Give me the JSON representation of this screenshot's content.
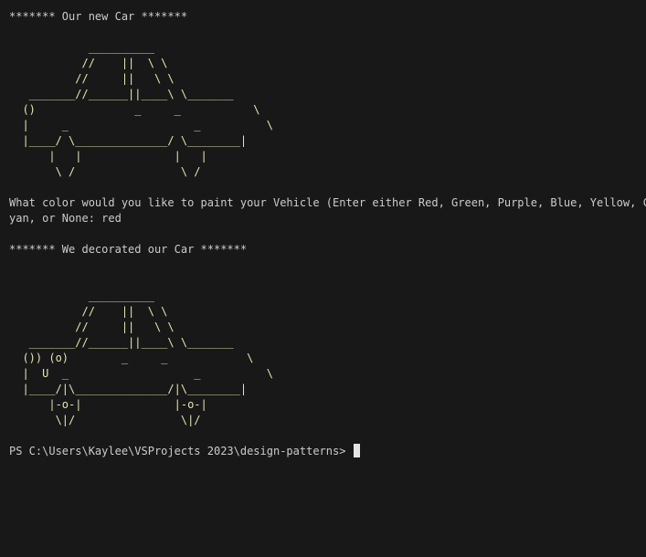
{
  "terminal": {
    "title_line": "******* Our new Car *******",
    "car_original": [
      "            __________",
      "           //    ||  \\ \\",
      "          //     ||   \\ \\",
      "   _______//______||____\\ \\_______",
      "  ()               _     _           \\",
      "  |     _                   _          \\",
      "  |____/ \\______________/ \\________|",
      "      |   |              |   |",
      "       \\ /                \\ /"
    ],
    "prompt_line_1": "What color would you like to paint your Vehicle (Enter either Red, Green, Purple, Blue, Yellow, C",
    "prompt_line_2": "yan, or None: red",
    "decorated_line": "******* We decorated our Car *******",
    "car_decorated": [
      "            __________",
      "           //    ||  \\ \\",
      "          //     ||   \\ \\",
      "   _______//______||____\\ \\_______",
      "  ()) (o)        _     _            \\",
      "  |  U  _                   _          \\",
      "  |____/|\\______________/|\\________|",
      "      |-o-|              |-o-|",
      "       \\|/                \\|/"
    ],
    "shell_prompt": "PS C:\\Users\\Kaylee\\VSProjects 2023\\design-patterns> "
  }
}
